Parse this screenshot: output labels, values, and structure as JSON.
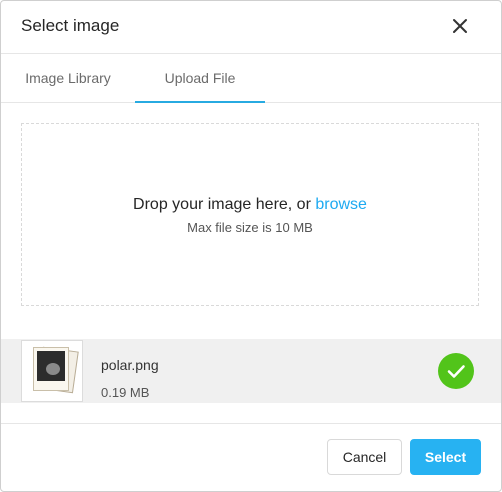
{
  "dialog": {
    "title": "Select image"
  },
  "tabs": [
    {
      "label": "Image Library",
      "active": false
    },
    {
      "label": "Upload File",
      "active": true
    }
  ],
  "dropzone": {
    "prompt": "Drop your image here, or ",
    "browse_label": "browse",
    "max_size_text": "Max file size is 10 MB"
  },
  "file": {
    "name": "polar.png",
    "size": "0.19 MB",
    "status": "uploaded",
    "thumbnail_icon": "image-thumbnail",
    "status_icon": "check-circle-icon"
  },
  "footer": {
    "cancel_label": "Cancel",
    "select_label": "Select"
  },
  "colors": {
    "accent": "#27b2f2",
    "link": "#1eaaf1",
    "success": "#52c41a",
    "tab_underline": "#27aae1"
  }
}
